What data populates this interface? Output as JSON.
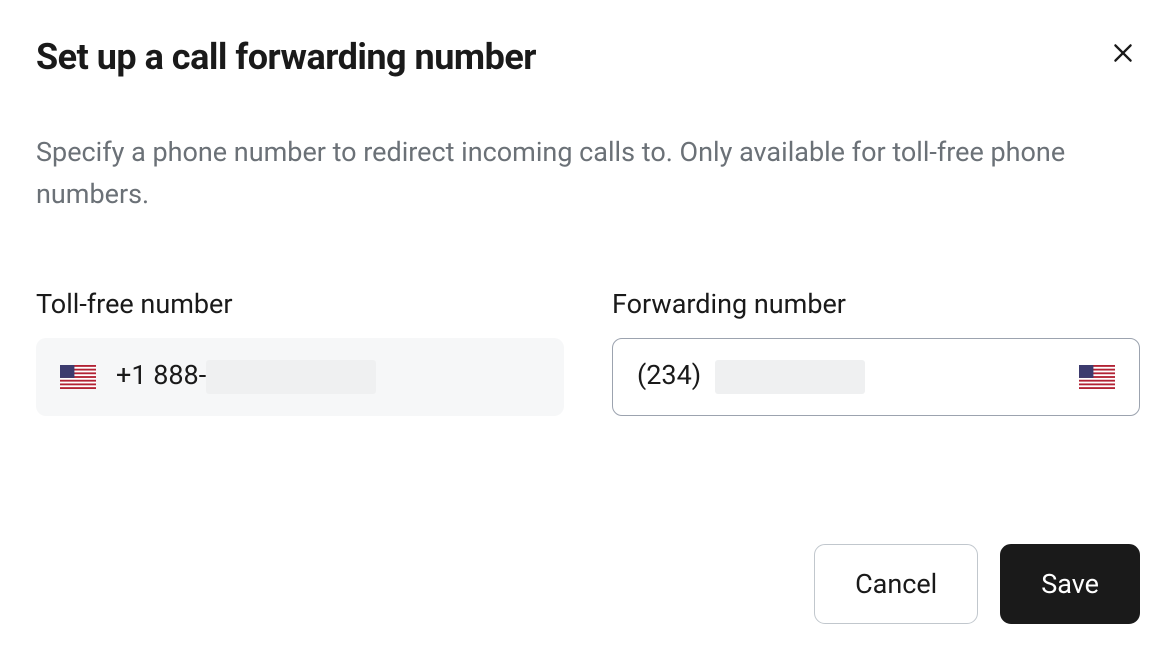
{
  "modal": {
    "title": "Set up a call forwarding number",
    "description": "Specify a phone number to redirect incoming calls to. Only available for toll-free phone numbers."
  },
  "fields": {
    "tollFree": {
      "label": "Toll-free number",
      "countryCode": "US",
      "prefix": "+1  888-"
    },
    "forwarding": {
      "label": "Forwarding number",
      "countryCode": "US",
      "prefix": "(234)"
    }
  },
  "actions": {
    "cancel": "Cancel",
    "save": "Save"
  }
}
